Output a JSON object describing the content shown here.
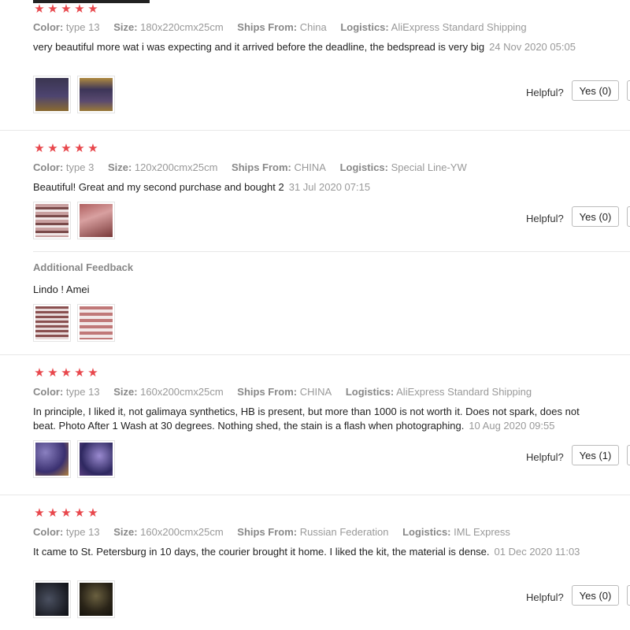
{
  "reviews": [
    {
      "stars": "★★★★★",
      "meta": [
        {
          "k": "Color:",
          "v": "type 13"
        },
        {
          "k": "Size:",
          "v": "180x220cmx25cm"
        },
        {
          "k": "Ships From:",
          "v": "China"
        },
        {
          "k": "Logistics:",
          "v": "AliExpress Standard Shipping"
        }
      ],
      "text": "very beautiful more wat i was expecting and it arrived before the deadline, the bedspread is very big",
      "date": "24 Nov 2020 05:05",
      "helpful_label": "Helpful?",
      "yes_label": "Yes (0)"
    },
    {
      "stars": "★★★★★",
      "meta": [
        {
          "k": "Color:",
          "v": "type 3"
        },
        {
          "k": "Size:",
          "v": "120x200cmx25cm"
        },
        {
          "k": "Ships From:",
          "v": "CHINA"
        },
        {
          "k": "Logistics:",
          "v": "Special Line-YW"
        }
      ],
      "text": "Beautiful! Great and my second purchase and bought 2",
      "date": "31 Jul 2020 07:15",
      "helpful_label": "Helpful?",
      "yes_label": "Yes (0)",
      "additional_title": "Additional Feedback",
      "additional_text": "Lindo ! Amei"
    },
    {
      "stars": "★★★★★",
      "meta": [
        {
          "k": "Color:",
          "v": "type 13"
        },
        {
          "k": "Size:",
          "v": "160x200cmx25cm"
        },
        {
          "k": "Ships From:",
          "v": "CHINA"
        },
        {
          "k": "Logistics:",
          "v": "AliExpress Standard Shipping"
        }
      ],
      "text": "In principle, I liked it, not galimaya synthetics, HB is present, but more than 1000 is not worth it. Does not spark, does not beat. Photo After 1 Wash at 30 degrees. Nothing shed, the stain is a flash when photographing.",
      "date": "10 Aug 2020 09:55",
      "helpful_label": "Helpful?",
      "yes_label": "Yes (1)"
    },
    {
      "stars": "★★★★★",
      "meta": [
        {
          "k": "Color:",
          "v": "type 13"
        },
        {
          "k": "Size:",
          "v": "160x200cmx25cm"
        },
        {
          "k": "Ships From:",
          "v": "Russian Federation"
        },
        {
          "k": "Logistics:",
          "v": "IML Express"
        }
      ],
      "text": "It came to St. Petersburg in 10 days, the courier brought it home. I liked the kit, the material is dense.",
      "date": "01 Dec 2020 11:03",
      "helpful_label": "Helpful?",
      "yes_label": "Yes (0)"
    }
  ]
}
